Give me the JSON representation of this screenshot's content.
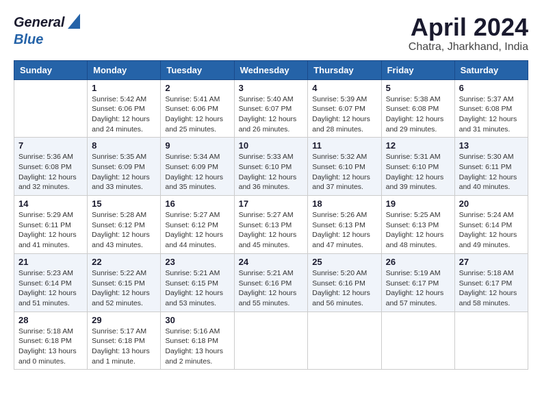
{
  "header": {
    "logo_general": "General",
    "logo_blue": "Blue",
    "month": "April 2024",
    "location": "Chatra, Jharkhand, India"
  },
  "weekdays": [
    "Sunday",
    "Monday",
    "Tuesday",
    "Wednesday",
    "Thursday",
    "Friday",
    "Saturday"
  ],
  "weeks": [
    {
      "days": [
        {
          "num": "",
          "info": ""
        },
        {
          "num": "1",
          "info": "Sunrise: 5:42 AM\nSunset: 6:06 PM\nDaylight: 12 hours\nand 24 minutes."
        },
        {
          "num": "2",
          "info": "Sunrise: 5:41 AM\nSunset: 6:06 PM\nDaylight: 12 hours\nand 25 minutes."
        },
        {
          "num": "3",
          "info": "Sunrise: 5:40 AM\nSunset: 6:07 PM\nDaylight: 12 hours\nand 26 minutes."
        },
        {
          "num": "4",
          "info": "Sunrise: 5:39 AM\nSunset: 6:07 PM\nDaylight: 12 hours\nand 28 minutes."
        },
        {
          "num": "5",
          "info": "Sunrise: 5:38 AM\nSunset: 6:08 PM\nDaylight: 12 hours\nand 29 minutes."
        },
        {
          "num": "6",
          "info": "Sunrise: 5:37 AM\nSunset: 6:08 PM\nDaylight: 12 hours\nand 31 minutes."
        }
      ]
    },
    {
      "days": [
        {
          "num": "7",
          "info": "Sunrise: 5:36 AM\nSunset: 6:08 PM\nDaylight: 12 hours\nand 32 minutes."
        },
        {
          "num": "8",
          "info": "Sunrise: 5:35 AM\nSunset: 6:09 PM\nDaylight: 12 hours\nand 33 minutes."
        },
        {
          "num": "9",
          "info": "Sunrise: 5:34 AM\nSunset: 6:09 PM\nDaylight: 12 hours\nand 35 minutes."
        },
        {
          "num": "10",
          "info": "Sunrise: 5:33 AM\nSunset: 6:10 PM\nDaylight: 12 hours\nand 36 minutes."
        },
        {
          "num": "11",
          "info": "Sunrise: 5:32 AM\nSunset: 6:10 PM\nDaylight: 12 hours\nand 37 minutes."
        },
        {
          "num": "12",
          "info": "Sunrise: 5:31 AM\nSunset: 6:10 PM\nDaylight: 12 hours\nand 39 minutes."
        },
        {
          "num": "13",
          "info": "Sunrise: 5:30 AM\nSunset: 6:11 PM\nDaylight: 12 hours\nand 40 minutes."
        }
      ]
    },
    {
      "days": [
        {
          "num": "14",
          "info": "Sunrise: 5:29 AM\nSunset: 6:11 PM\nDaylight: 12 hours\nand 41 minutes."
        },
        {
          "num": "15",
          "info": "Sunrise: 5:28 AM\nSunset: 6:12 PM\nDaylight: 12 hours\nand 43 minutes."
        },
        {
          "num": "16",
          "info": "Sunrise: 5:27 AM\nSunset: 6:12 PM\nDaylight: 12 hours\nand 44 minutes."
        },
        {
          "num": "17",
          "info": "Sunrise: 5:27 AM\nSunset: 6:13 PM\nDaylight: 12 hours\nand 45 minutes."
        },
        {
          "num": "18",
          "info": "Sunrise: 5:26 AM\nSunset: 6:13 PM\nDaylight: 12 hours\nand 47 minutes."
        },
        {
          "num": "19",
          "info": "Sunrise: 5:25 AM\nSunset: 6:13 PM\nDaylight: 12 hours\nand 48 minutes."
        },
        {
          "num": "20",
          "info": "Sunrise: 5:24 AM\nSunset: 6:14 PM\nDaylight: 12 hours\nand 49 minutes."
        }
      ]
    },
    {
      "days": [
        {
          "num": "21",
          "info": "Sunrise: 5:23 AM\nSunset: 6:14 PM\nDaylight: 12 hours\nand 51 minutes."
        },
        {
          "num": "22",
          "info": "Sunrise: 5:22 AM\nSunset: 6:15 PM\nDaylight: 12 hours\nand 52 minutes."
        },
        {
          "num": "23",
          "info": "Sunrise: 5:21 AM\nSunset: 6:15 PM\nDaylight: 12 hours\nand 53 minutes."
        },
        {
          "num": "24",
          "info": "Sunrise: 5:21 AM\nSunset: 6:16 PM\nDaylight: 12 hours\nand 55 minutes."
        },
        {
          "num": "25",
          "info": "Sunrise: 5:20 AM\nSunset: 6:16 PM\nDaylight: 12 hours\nand 56 minutes."
        },
        {
          "num": "26",
          "info": "Sunrise: 5:19 AM\nSunset: 6:17 PM\nDaylight: 12 hours\nand 57 minutes."
        },
        {
          "num": "27",
          "info": "Sunrise: 5:18 AM\nSunset: 6:17 PM\nDaylight: 12 hours\nand 58 minutes."
        }
      ]
    },
    {
      "days": [
        {
          "num": "28",
          "info": "Sunrise: 5:18 AM\nSunset: 6:18 PM\nDaylight: 13 hours\nand 0 minutes."
        },
        {
          "num": "29",
          "info": "Sunrise: 5:17 AM\nSunset: 6:18 PM\nDaylight: 13 hours\nand 1 minute."
        },
        {
          "num": "30",
          "info": "Sunrise: 5:16 AM\nSunset: 6:18 PM\nDaylight: 13 hours\nand 2 minutes."
        },
        {
          "num": "",
          "info": ""
        },
        {
          "num": "",
          "info": ""
        },
        {
          "num": "",
          "info": ""
        },
        {
          "num": "",
          "info": ""
        }
      ]
    }
  ]
}
